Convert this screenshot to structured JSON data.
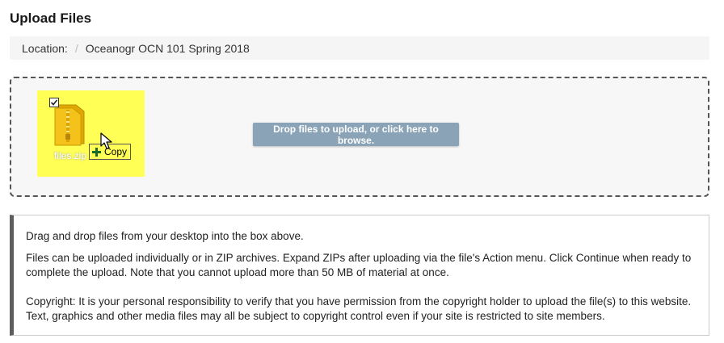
{
  "page": {
    "title": "Upload Files"
  },
  "breadcrumb": {
    "label": "Location:",
    "separator": "/",
    "current": "Oceanogr OCN 101 Spring 2018"
  },
  "dropzone": {
    "drag_preview": {
      "file_name": "files.zip",
      "tooltip_label": "Copy",
      "checkbox_icon": "checkbox-icon",
      "file_icon": "zip-folder-icon",
      "cursor_icon": "cursor-arrow-icon",
      "plus_icon": "plus-icon",
      "highlight_color": "#ffff55"
    },
    "button_label": "Drop files to upload, or click here to browse.",
    "button_color": "#8aa3b6"
  },
  "info": {
    "line1": "Drag and drop files from your desktop into the box above.",
    "line2": "Files can be uploaded individually or in ZIP archives. Expand ZIPs after uploading via the file's Action menu. Click Continue when ready to complete the upload. Note that you cannot upload more than 50 MB of material at once.",
    "line3": "Copyright: It is your personal responsibility to verify that you have permission from the copyright holder to upload the file(s) to this website. Text, graphics and other media files may all be subject to copyright control even if your site is restricted to site members."
  }
}
